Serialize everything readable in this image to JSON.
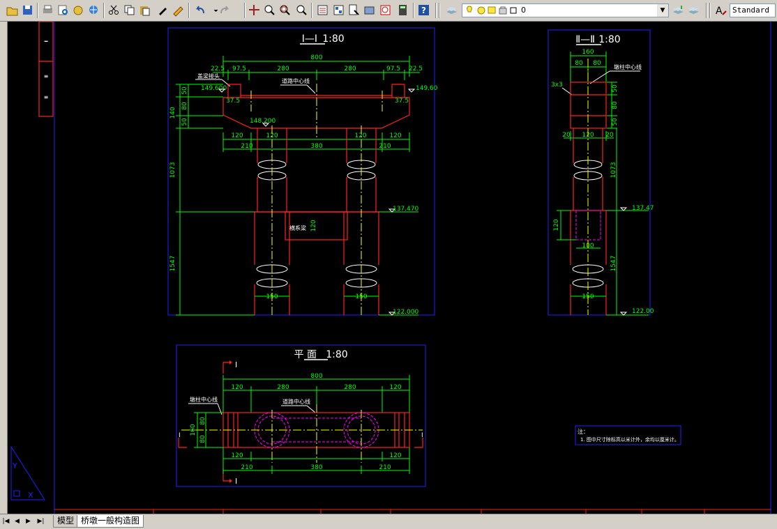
{
  "toolbar": {
    "layer_name": "0",
    "text_style": "Standard"
  },
  "tabs": {
    "model": "模型",
    "layout": "桥墩一般构造图"
  },
  "drawing": {
    "section1": {
      "title_roman": "I—I",
      "scale": "1:80",
      "total_width": "800",
      "top_dims": [
        "22.5",
        "97.5",
        "280",
        "280",
        "97.5",
        "22.5"
      ],
      "elev_left": "149.600",
      "elev_right": "149.60",
      "elev_mid": "148.200",
      "slope_l": "37.5",
      "slope_r": "37.5",
      "vert_dims": [
        "50",
        "80",
        "50"
      ],
      "vert_total": "140",
      "col_dims": [
        "120",
        "120",
        "120",
        "120"
      ],
      "bottom_dims": [
        "210",
        "380",
        "210"
      ],
      "height_mid": "1073",
      "height_low": "1547",
      "tie_height": "120",
      "col_dia": [
        "150",
        "150"
      ],
      "elev_tie": "137.470",
      "elev_base": "122.000",
      "label_cap": "盖梁接头",
      "label_center": "道路中心线",
      "label_tie": "横系梁"
    },
    "section2": {
      "title_roman": "Ⅱ—Ⅱ",
      "scale": "1:80",
      "top_dim": "160",
      "half_dims": [
        "80",
        "80"
      ],
      "chamfer": "3x3",
      "vert_dims": [
        "50",
        "80",
        "50"
      ],
      "col_dims": [
        "20",
        "120",
        "20"
      ],
      "height_mid": "1073",
      "height_low": "1547",
      "tie_height": "120",
      "tie_width": "100",
      "col_dia": "150",
      "elev_tie": "137.47",
      "elev_base": "122.00",
      "label_center": "墩柱中心线"
    },
    "plan": {
      "title": "平 面",
      "scale": "1:80",
      "total_width": "800",
      "top_dims": [
        "120",
        "280",
        "280",
        "120"
      ],
      "bottom_top_dims": [
        "120",
        "120"
      ],
      "bottom_dims": [
        "210",
        "380",
        "210"
      ],
      "vert_total": "160",
      "vert_dims": [
        "80",
        "80"
      ],
      "cut_mark": "I",
      "label_pier": "墩柱中心线",
      "label_road": "道路中心线"
    },
    "note": {
      "title": "注：",
      "line1": "1. 图中尺寸除标高以米计外，余均以厘米计。"
    },
    "ucs": {
      "y": "Y",
      "x": "X"
    }
  }
}
